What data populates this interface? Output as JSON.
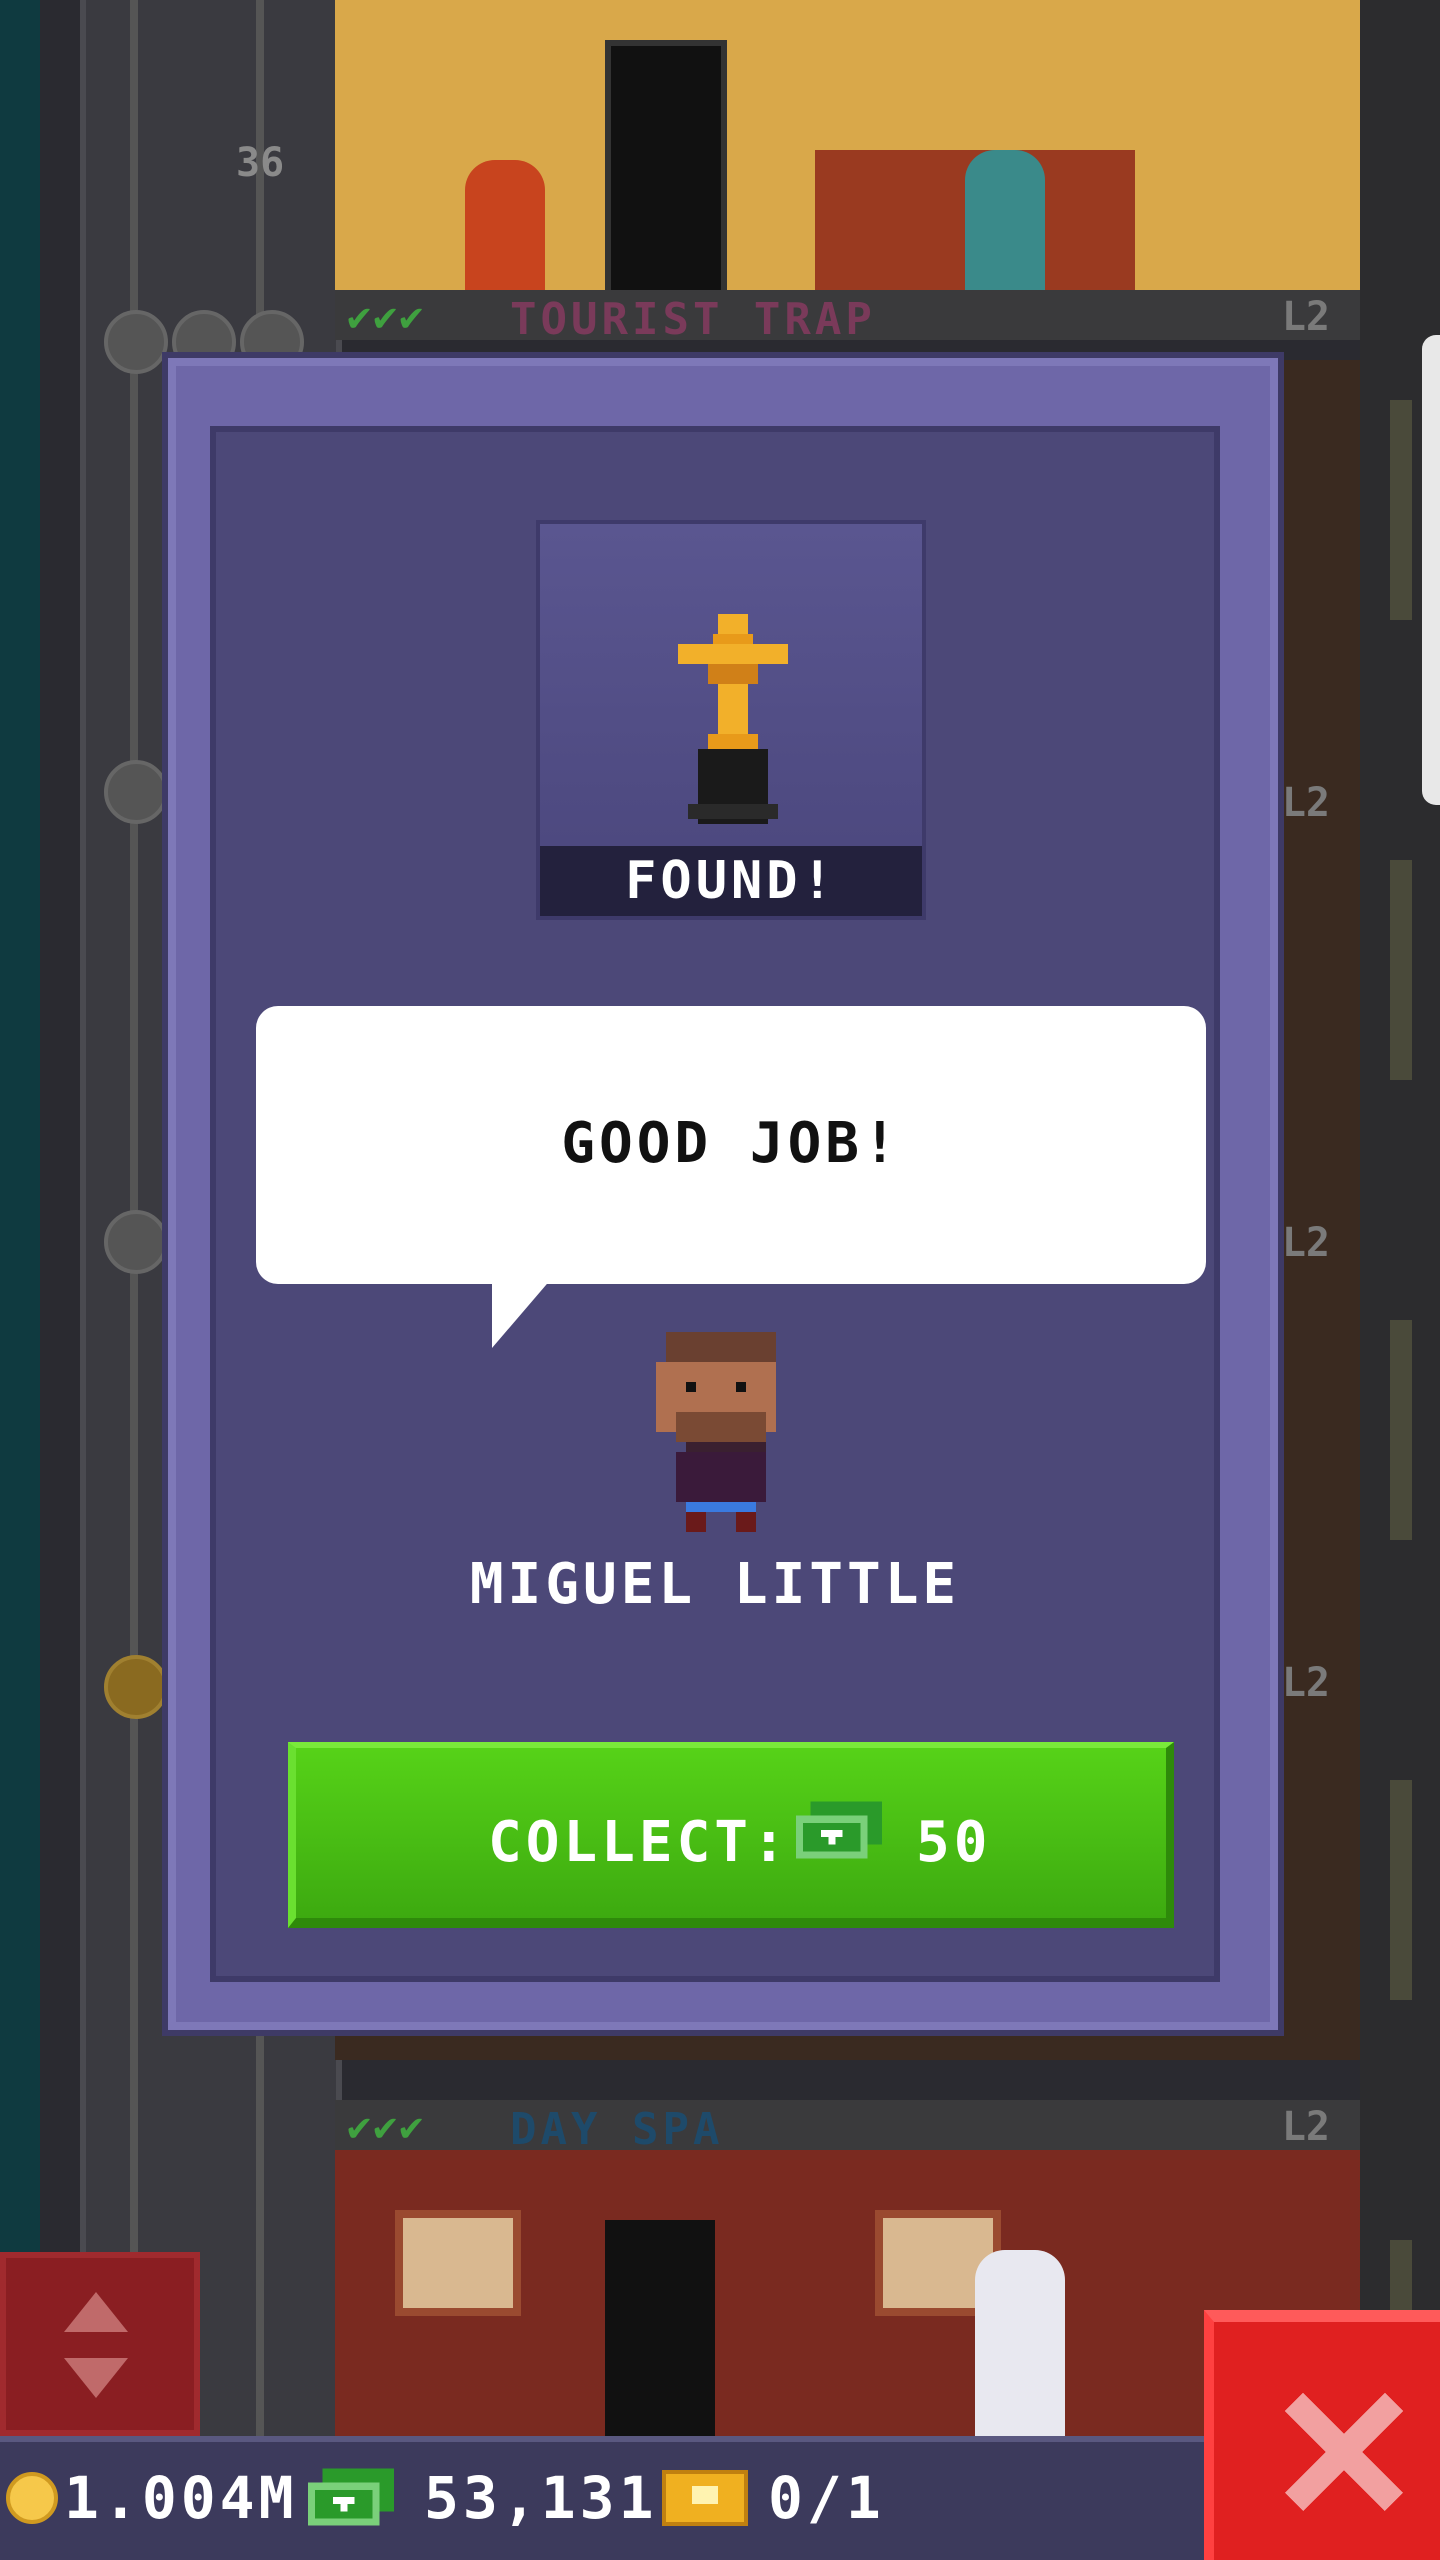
{
  "background": {
    "floor_number": "36",
    "top_floor": {
      "name": "TOURIST TRAP",
      "level": "L2",
      "checks": "✔✔✔"
    },
    "bottom_floor": {
      "name": "DAY SPA",
      "level": "L2",
      "checks": "✔✔✔"
    },
    "side_levels": [
      "L2",
      "L2",
      "L2",
      "L2",
      "L2"
    ]
  },
  "modal": {
    "status_banner": "FOUND!",
    "speech": "GOOD JOB!",
    "character_name": "MIGUEL LITTLE",
    "collect": {
      "label": "COLLECT:",
      "amount": "50"
    }
  },
  "hud": {
    "coins": "1.004M",
    "bux": "53,131",
    "tickets": "0/1"
  },
  "colors": {
    "modal_frame": "#6e67a8",
    "modal_inner": "#4c4878",
    "collect_button": "#4cc414",
    "close_button": "#e02020",
    "tourist_trap_title": "#7a3a5a",
    "day_spa_title": "#1e4a6a"
  },
  "icons": {
    "trophy": "trophy-icon",
    "cash": "bux-icon",
    "coin": "coin-icon",
    "ticket": "golden-ticket-icon",
    "close": "close-icon",
    "elevator": "elevator-arrows-icon"
  }
}
